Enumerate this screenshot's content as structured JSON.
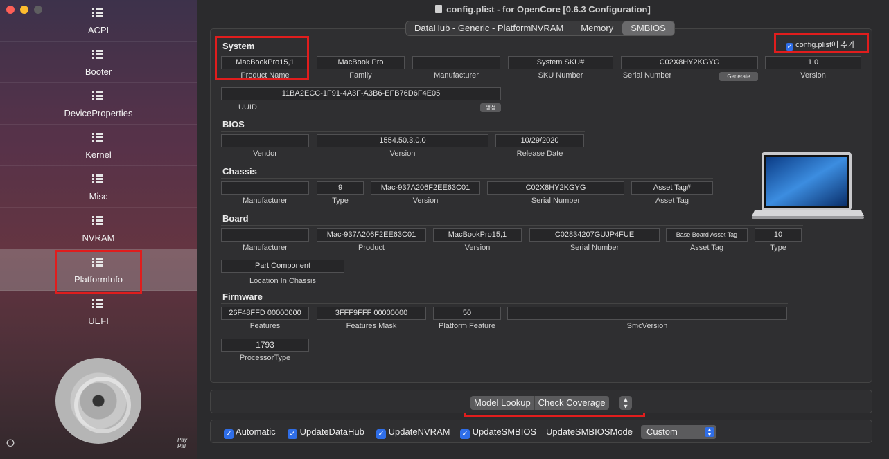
{
  "window": {
    "title": "config.plist - for OpenCore [0.6.3 Configuration]"
  },
  "sidebar": {
    "items": [
      {
        "label": "ACPI"
      },
      {
        "label": "Booter"
      },
      {
        "label": "DeviceProperties"
      },
      {
        "label": "Kernel"
      },
      {
        "label": "Misc"
      },
      {
        "label": "NVRAM"
      },
      {
        "label": "PlatformInfo"
      },
      {
        "label": "UEFI"
      }
    ],
    "active": "PlatformInfo",
    "paypal": "Pay Pal",
    "icons": [
      "list-icon",
      "share-icon",
      "disk-icon"
    ]
  },
  "tabs": [
    {
      "label": "DataHub - Generic - PlatformNVRAM"
    },
    {
      "label": "Memory"
    },
    {
      "label": "SMBIOS"
    }
  ],
  "selected_tab": "SMBIOS",
  "add_config": {
    "label": "config.plist에 추가",
    "checked": true
  },
  "system": {
    "title": "System",
    "product_name": {
      "value": "MacBookPro15,1",
      "label": "Product Name"
    },
    "family": {
      "value": "MacBook Pro",
      "label": "Family"
    },
    "manufacturer": {
      "value": "",
      "label": "Manufacturer"
    },
    "sku_number": {
      "value": "System SKU#",
      "label": "SKU Number"
    },
    "serial_number": {
      "value": "C02X8HY2KGYG",
      "label": "Serial Number"
    },
    "generate_button": "Generate",
    "version": {
      "value": "1.0",
      "label": "Version"
    },
    "uuid": {
      "value": "11BA2ECC-1F91-4A3F-A3B6-EFB76D6F4E05",
      "label": "UUID"
    },
    "uuid_button": "생성"
  },
  "bios": {
    "title": "BIOS",
    "vendor": {
      "value": "",
      "label": "Vendor"
    },
    "version": {
      "value": "1554.50.3.0.0",
      "label": "Version"
    },
    "release_date": {
      "value": "10/29/2020",
      "label": "Release Date"
    }
  },
  "chassis": {
    "title": "Chassis",
    "manufacturer": {
      "value": "",
      "label": "Manufacturer"
    },
    "type": {
      "value": "9",
      "label": "Type"
    },
    "version": {
      "value": "Mac-937A206F2EE63C01",
      "label": "Version"
    },
    "serial_number": {
      "value": "C02X8HY2KGYG",
      "label": "Serial Number"
    },
    "asset_tag": {
      "value": "Asset Tag#",
      "label": "Asset Tag"
    }
  },
  "board": {
    "title": "Board",
    "manufacturer": {
      "value": "",
      "label": "Manufacturer"
    },
    "product": {
      "value": "Mac-937A206F2EE63C01",
      "label": "Product"
    },
    "version": {
      "value": "MacBookPro15,1",
      "label": "Version"
    },
    "serial_number": {
      "value": "C02834207GUJP4FUE",
      "label": "Serial Number"
    },
    "asset_tag": {
      "value": "Base Board Asset Tag",
      "label": "Asset Tag"
    },
    "type": {
      "value": "10",
      "label": "Type"
    },
    "location": {
      "value": "Part Component",
      "label": "Location In Chassis"
    }
  },
  "firmware": {
    "title": "Firmware",
    "features": {
      "value": "26F48FFD 00000000",
      "label": "Features"
    },
    "features_mask": {
      "value": "3FFF9FFF 00000000",
      "label": "Features Mask"
    },
    "platform_feature": {
      "value": "50",
      "label": "Platform Feature"
    },
    "smc_version": {
      "value": "",
      "label": "SmcVersion"
    },
    "processor_type": {
      "value": "1793",
      "label": "ProcessorType"
    }
  },
  "lookup": {
    "model_lookup": "Model Lookup",
    "check_coverage": "Check Coverage"
  },
  "options": {
    "automatic": "Automatic",
    "update_datahub": "UpdateDataHub",
    "update_nvram": "UpdateNVRAM",
    "update_smbios": "UpdateSMBIOS",
    "update_smbios_mode_label": "UpdateSMBIOSMode",
    "update_smbios_mode_value": "Custom"
  },
  "colors": {
    "accent": "#2f6ee8",
    "highlight": "#e01d1d"
  }
}
